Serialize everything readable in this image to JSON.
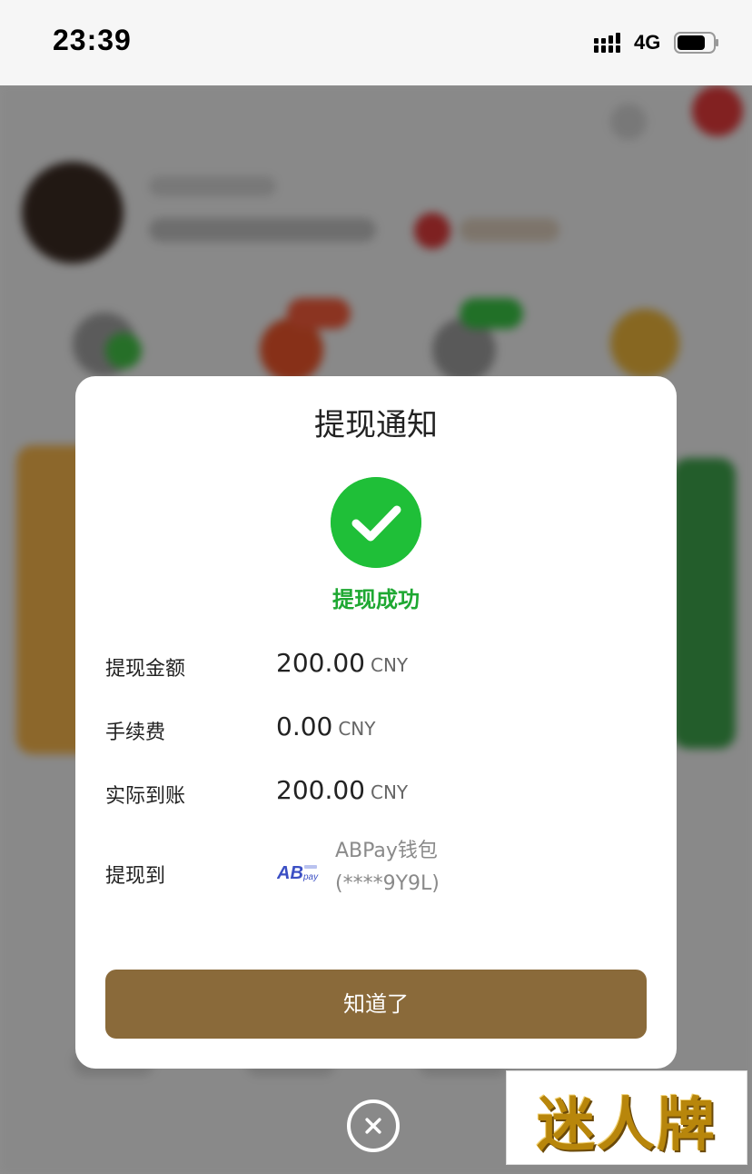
{
  "status_bar": {
    "time": "23:39",
    "network": "4G",
    "icons": [
      "signal-icon",
      "battery-icon"
    ]
  },
  "dialog": {
    "title": "提现通知",
    "status_icon": "check-icon",
    "status_text": "提现成功",
    "status_color": "#1fbf38",
    "rows": [
      {
        "label": "提现金额",
        "amount": "200.00",
        "unit": "CNY"
      },
      {
        "label": "手续费",
        "amount": "0.00",
        "unit": "CNY"
      },
      {
        "label": "实际到账",
        "amount": "200.00",
        "unit": "CNY"
      }
    ],
    "destination": {
      "label": "提现到",
      "logo_icon": "abpay-logo-icon",
      "logo_text": "AB",
      "logo_subtext": "pay",
      "wallet_name": "ABPay钱包",
      "wallet_account": "(****9Y9L)"
    },
    "confirm_button": "知道了",
    "button_color": "#8a6a3a",
    "close_icon": "close-circle-icon"
  },
  "watermark": {
    "text": "迷人牌"
  }
}
